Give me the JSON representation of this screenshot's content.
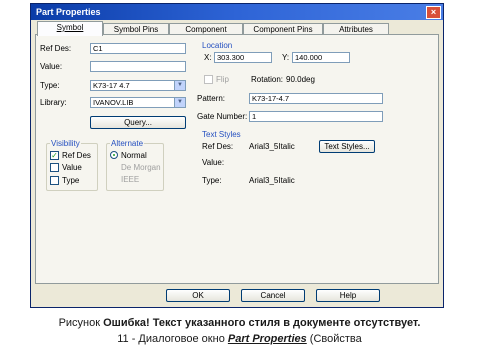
{
  "window": {
    "title": "Part Properties",
    "close_glyph": "×"
  },
  "tabs": [
    "Symbol",
    "Symbol Pins",
    "Component",
    "Component Pins",
    "Attributes"
  ],
  "symbol": {
    "refdes_label": "Ref Des:",
    "refdes_value": "C1",
    "value_label": "Value:",
    "value_value": "",
    "type_label": "Type:",
    "type_value": "K73-17 4.7",
    "library_label": "Library:",
    "library_value": "IVANOV.LIB",
    "query_button": "Query..."
  },
  "location": {
    "heading": "Location",
    "x_label": "X:",
    "x_value": "303.300",
    "y_label": "Y:",
    "y_value": "140.000",
    "flip_label": "Flip",
    "rotation_label": "Rotation:",
    "rotation_value": "90.0deg",
    "pattern_label": "Pattern:",
    "pattern_value": "K73-17-4.7",
    "gate_label": "Gate Number:",
    "gate_value": "1"
  },
  "visibility": {
    "heading": "Visibility",
    "items": [
      {
        "label": "Ref Des",
        "checked": true
      },
      {
        "label": "Value",
        "checked": false
      },
      {
        "label": "Type",
        "checked": false
      }
    ]
  },
  "alternate": {
    "heading": "Alternate",
    "items": [
      {
        "label": "Normal",
        "selected": true
      },
      {
        "label": "De Morgan",
        "selected": false
      },
      {
        "label": "IEEE",
        "selected": false
      }
    ]
  },
  "text_styles": {
    "heading": "Text Styles",
    "refdes_label": "Ref Des:",
    "refdes_value": "Arial3_5Italic",
    "value_label": "Value:",
    "value_value": "",
    "type_label": "Type:",
    "type_value": "Arial3_5Italic",
    "button": "Text Styles..."
  },
  "footer": {
    "ok": "OK",
    "cancel": "Cancel",
    "help": "Help"
  },
  "caption": {
    "prefix": "Рисунок ",
    "error_bold": "Ошибка! Текст указанного стиля в документе отсутствует.",
    "middle": " 11 - Диалоговое окно ",
    "italic": "Part Properties",
    "suffix": " (Свойства"
  }
}
